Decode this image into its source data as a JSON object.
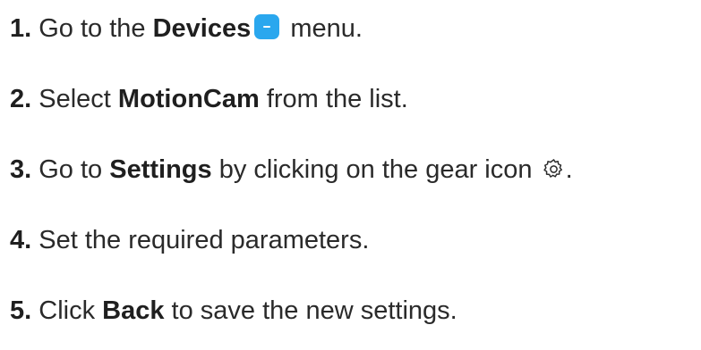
{
  "steps": [
    {
      "number": "1.",
      "pre": " Go to the ",
      "bold": "Devices",
      "post": " menu.",
      "icon": "devices-icon",
      "icon_color": "#2aa7ee"
    },
    {
      "number": "2.",
      "pre": " Select ",
      "bold": "MotionCam",
      "post": " from the list."
    },
    {
      "number": "3.",
      "pre": " Go to ",
      "bold": "Settings",
      "mid": " by clicking on the gear icon ",
      "post": ".",
      "icon": "gear-icon"
    },
    {
      "number": "4.",
      "pre": " Set the required parameters."
    },
    {
      "number": "5.",
      "pre": " Click ",
      "bold": "Back",
      "post": " to save the new settings."
    }
  ]
}
